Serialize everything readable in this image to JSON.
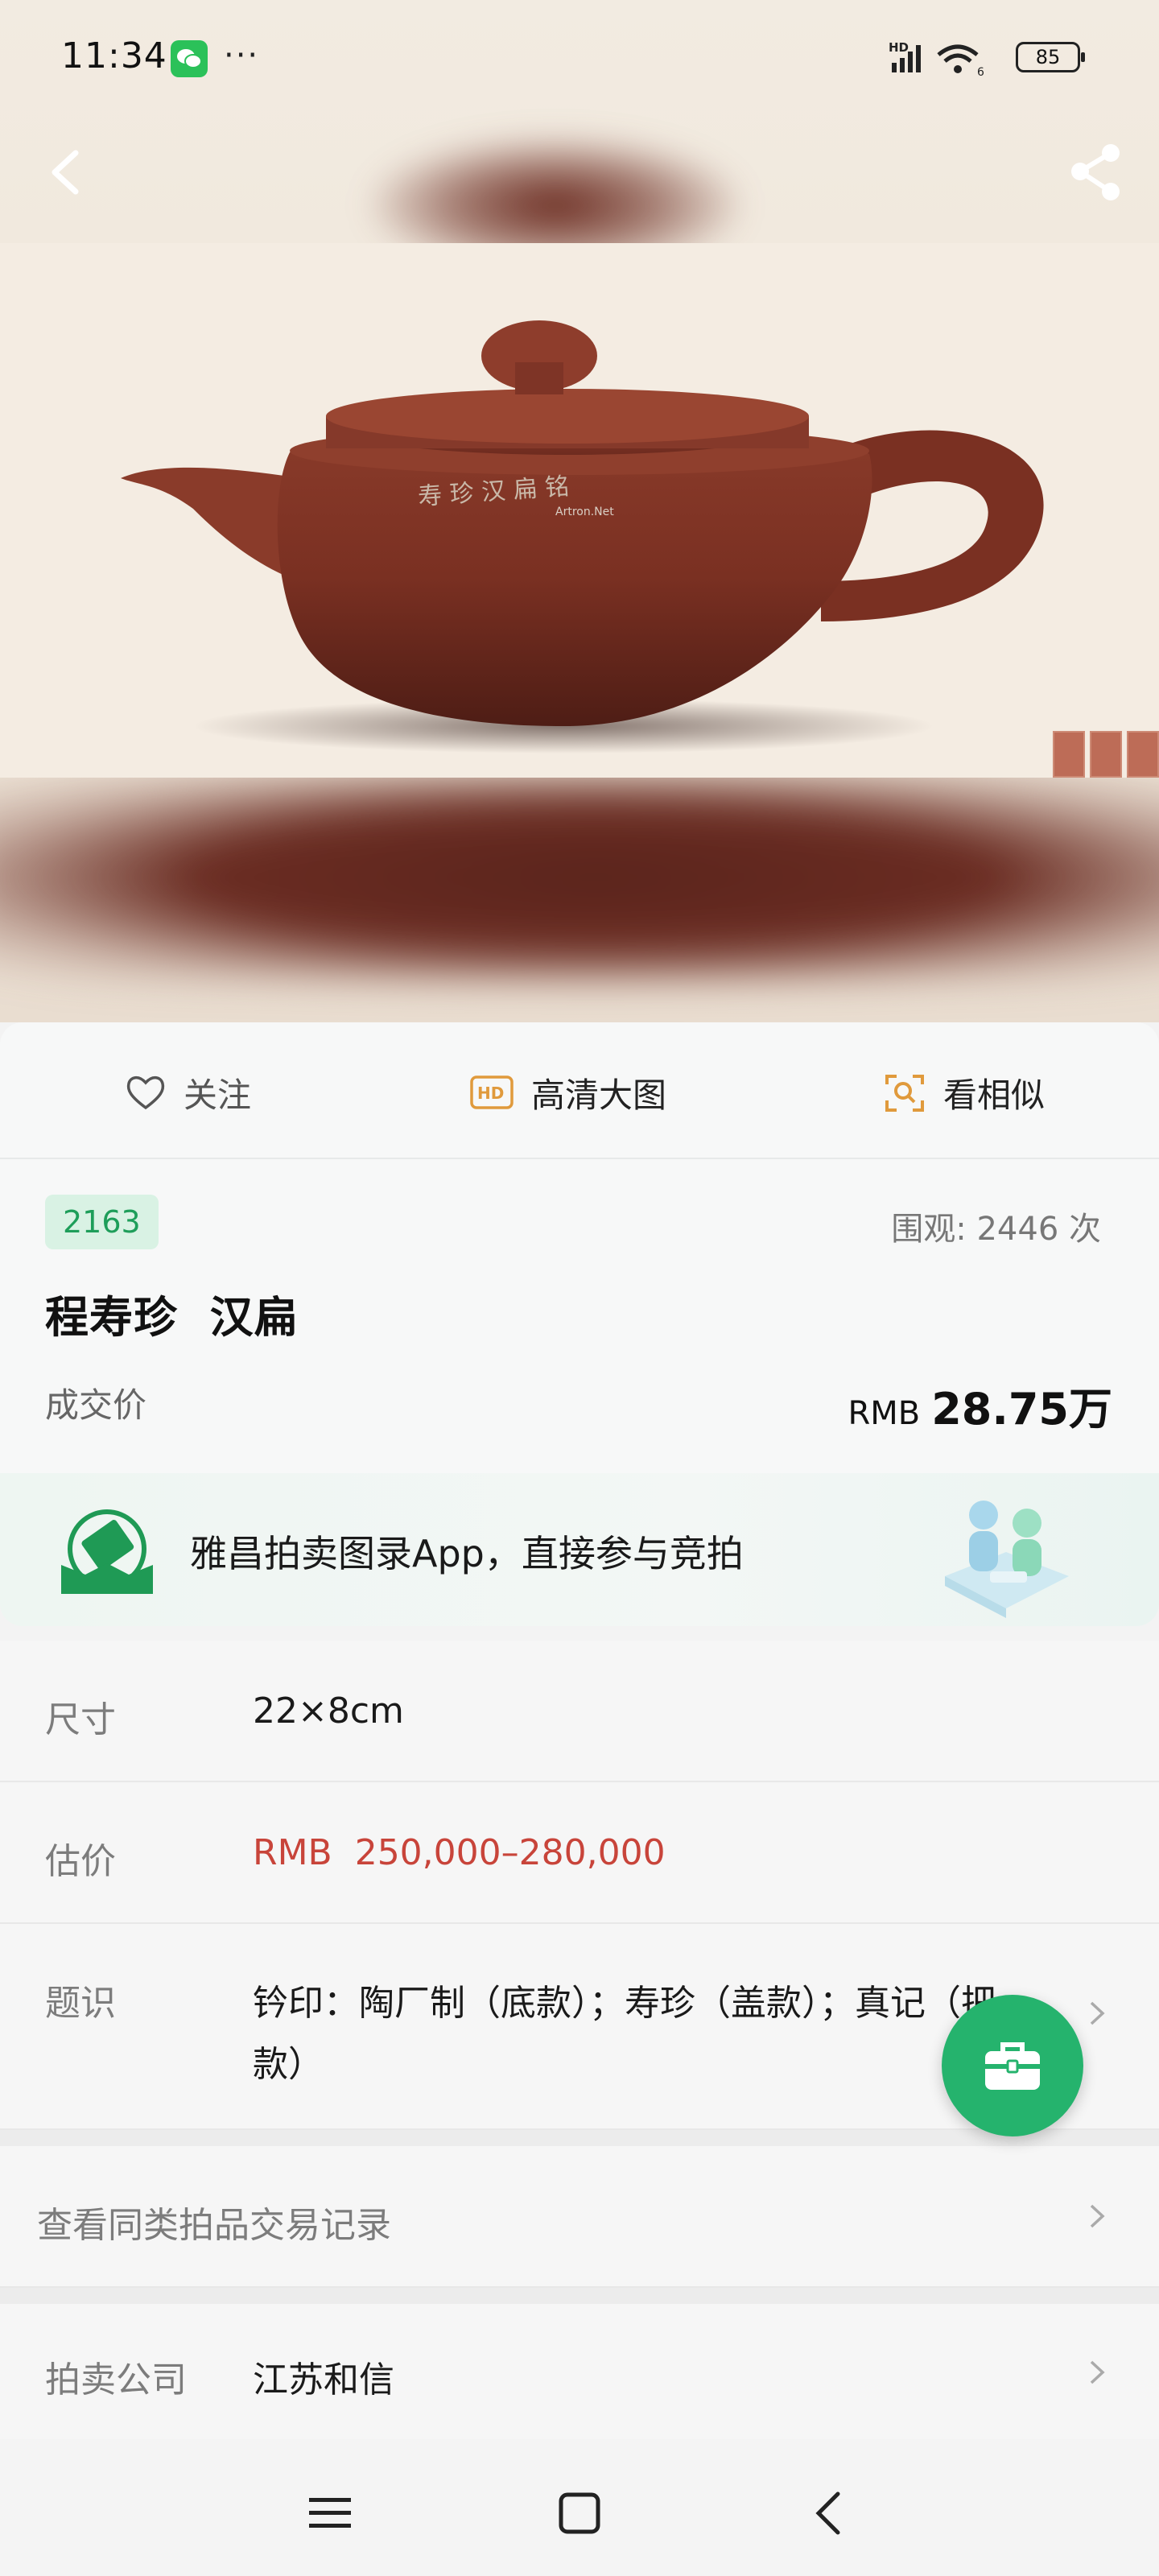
{
  "status_bar": {
    "time": "11:34",
    "more": "···",
    "hd_badge": "HD",
    "wifi_badge": "6",
    "battery": "85"
  },
  "hero": {
    "watermark": "Artron.Net",
    "icons": {
      "back": "back-arrow-icon",
      "share": "share-icon"
    }
  },
  "actions": {
    "follow": "关注",
    "hd_image": "高清大图",
    "hd_badge": "HD",
    "similar": "看相似"
  },
  "lot": {
    "number": "2163",
    "views_label": "围观:",
    "views_count": "2446",
    "views_unit": "次",
    "title": "程寿珍  汉扁",
    "price_label": "成交价",
    "price_currency": "RMB",
    "price_value": "28.75万"
  },
  "banner": {
    "text": "雅昌拍卖图录App，直接参与竞拍"
  },
  "details": {
    "size_label": "尺寸",
    "size_value": "22×8cm",
    "estimate_label": "估价",
    "estimate_value": "RMB  250,000–280,000",
    "inscription_label": "题识",
    "inscription_line1": "钤印：陶厂制（底款）；寿珍（盖款）；真记（把",
    "inscription_line2": "款）",
    "records_link": "查看同类拍品交易记录",
    "company_label": "拍卖公司",
    "company_value": "江苏和信"
  },
  "colors": {
    "accent_green": "#25b36d",
    "price_red": "#c8443a",
    "lot_badge_bg": "#d9f2e4",
    "hd_orange": "#e09a3c"
  }
}
